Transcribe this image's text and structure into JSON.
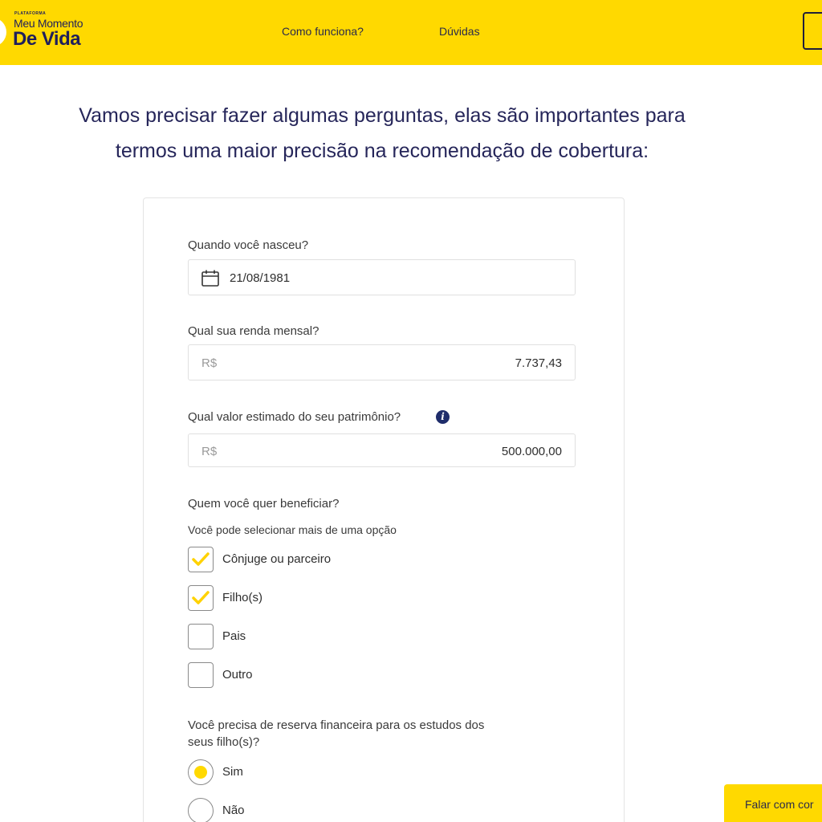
{
  "header": {
    "logo_small": "PLATAFORMA",
    "logo_line1": "Meu Momento",
    "logo_line2": "De Vida",
    "nav": [
      {
        "label": "Como funciona?"
      },
      {
        "label": "Dúvidas"
      }
    ],
    "brand_color": "#ffd900"
  },
  "intro": {
    "line1": "Vamos precisar fazer algumas perguntas, elas são importantes para",
    "line2": "termos uma maior precisão na recomendação de cobertura:"
  },
  "form": {
    "birth": {
      "label": "Quando você nasceu?",
      "value": "21/08/1981",
      "icon": "calendar-icon"
    },
    "income": {
      "label": "Qual sua renda mensal?",
      "prefix": "R$",
      "value": "7.737,43"
    },
    "patrimony": {
      "label": "Qual valor estimado do seu patrimônio?",
      "info_glyph": "i",
      "prefix": "R$",
      "value": "500.000,00"
    },
    "beneficiaries": {
      "label": "Quem você quer beneficiar?",
      "hint": "Você pode selecionar mais de uma opção",
      "options": [
        {
          "label": "Cônjuge ou parceiro",
          "checked": true
        },
        {
          "label": "Filho(s)",
          "checked": true
        },
        {
          "label": "Pais",
          "checked": false
        },
        {
          "label": "Outro",
          "checked": false
        }
      ]
    },
    "education": {
      "label_line1": "Você precisa de reserva financeira para os estudos dos",
      "label_line2": "seus filho(s)?",
      "options": [
        {
          "label": "Sim",
          "selected": true
        },
        {
          "label": "Não",
          "selected": false
        }
      ]
    }
  },
  "chat_button": {
    "label": "Falar com cor"
  }
}
